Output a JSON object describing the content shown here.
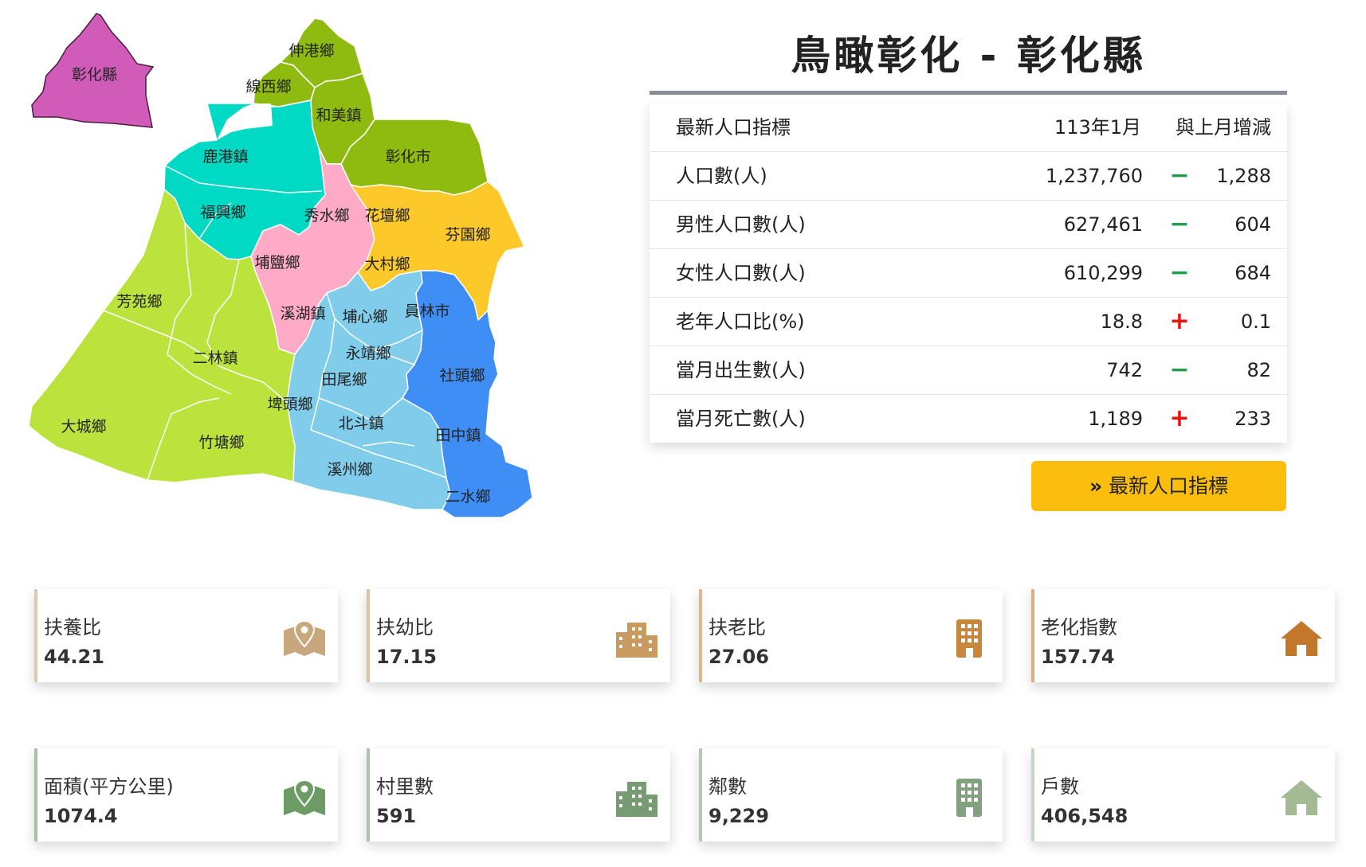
{
  "region_badge": {
    "label": "彰化縣",
    "color": "#d05bb8"
  },
  "map": {
    "townships": [
      "伸港鄉",
      "線西鄉",
      "和美鎮",
      "彰化市",
      "鹿港鎮",
      "福興鄉",
      "秀水鄉",
      "花壇鄉",
      "芬園鄉",
      "埔鹽鄉",
      "大村鄉",
      "芳苑鄉",
      "溪湖鎮",
      "埔心鄉",
      "員林市",
      "二林鎮",
      "永靖鄉",
      "田尾鄉",
      "社頭鄉",
      "埤頭鄉",
      "北斗鎮",
      "大城鄉",
      "竹塘鄉",
      "田中鎮",
      "溪州鄉",
      "二水鄉"
    ],
    "colors": {
      "olive": "#8fba10",
      "teal": "#00d9c3",
      "pink": "#ffaac6",
      "yellow": "#fcc82a",
      "lime": "#bbe33c",
      "sky": "#7fcceb",
      "blue": "#3f8ef5"
    }
  },
  "title": "鳥瞰彰化 -  彰化縣",
  "table": {
    "header": {
      "label": "最新人口指標",
      "period": "113年1月",
      "change_label": "與上月增減"
    },
    "rows": [
      {
        "label": "人口數(人)",
        "value": "1,237,760",
        "sign": "−",
        "change": "1,288",
        "direction": "down"
      },
      {
        "label": "男性人口數(人)",
        "value": "627,461",
        "sign": "−",
        "change": "604",
        "direction": "down"
      },
      {
        "label": "女性人口數(人)",
        "value": "610,299",
        "sign": "−",
        "change": "684",
        "direction": "down"
      },
      {
        "label": "老年人口比(%)",
        "value": "18.8",
        "sign": "+",
        "change": "0.1",
        "direction": "up"
      },
      {
        "label": "當月出生數(人)",
        "value": "742",
        "sign": "−",
        "change": "82",
        "direction": "down"
      },
      {
        "label": "當月死亡數(人)",
        "value": "1,189",
        "sign": "+",
        "change": "233",
        "direction": "up"
      }
    ],
    "sign_colors": {
      "down": "#1aa34a",
      "up": "#ee1111"
    }
  },
  "latest_button": {
    "label": "最新人口指標",
    "chevron": "»",
    "color": "#fcbe0e"
  },
  "cards": [
    {
      "title": "扶養比",
      "value": "44.21",
      "icon": "map-pin-icon",
      "color": "#c7a77b"
    },
    {
      "title": "扶幼比",
      "value": "17.15",
      "icon": "city-buildings-icon",
      "color": "#c99a60"
    },
    {
      "title": "扶老比",
      "value": "27.06",
      "icon": "office-building-icon",
      "color": "#c9873c"
    },
    {
      "title": "老化指數",
      "value": "157.74",
      "icon": "house-icon",
      "color": "#c3772a"
    },
    {
      "title": "面積(平方公里)",
      "value": "1074.4",
      "icon": "map-pin-icon",
      "color": "#6c9b63"
    },
    {
      "title": "村里數",
      "value": "591",
      "icon": "city-buildings-icon",
      "color": "#779b72"
    },
    {
      "title": "鄰數",
      "value": "9,229",
      "icon": "office-building-icon",
      "color": "#82a17e"
    },
    {
      "title": "戶數",
      "value": "406,548",
      "icon": "house-icon",
      "color": "#a4ba95"
    }
  ]
}
